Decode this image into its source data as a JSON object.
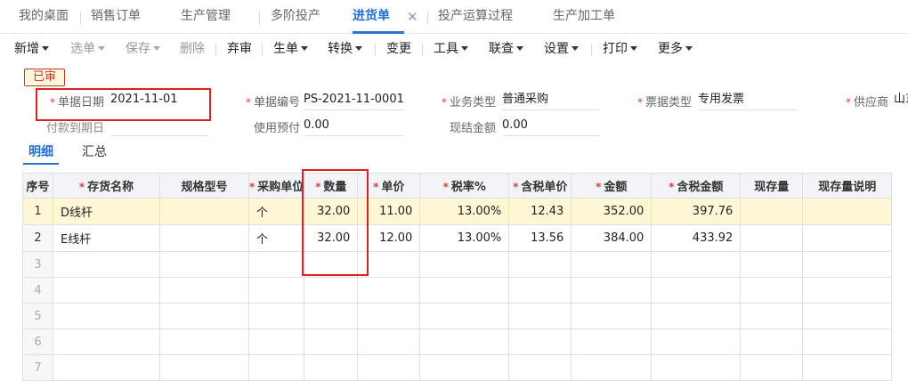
{
  "tabs": [
    {
      "label": "我的桌面"
    },
    {
      "label": "销售订单"
    },
    {
      "label": "生产管理"
    },
    {
      "label": "多阶投产"
    },
    {
      "label": "进货单"
    },
    {
      "label": "投产运算过程"
    },
    {
      "label": "生产加工单"
    }
  ],
  "tab_close_glyph": "✕",
  "toolbar": {
    "new": "新增",
    "pick": "选单",
    "save": "保存",
    "delete": "删除",
    "abandon": "弃审",
    "gen": "生单",
    "convert": "转换",
    "change": "变更",
    "tools": "工具",
    "query": "联查",
    "settings": "设置",
    "print": "打印",
    "more": "更多"
  },
  "status": "已审",
  "form": {
    "doc_date": {
      "label": "单据日期",
      "value": "2021-11-01"
    },
    "doc_no": {
      "label": "单据编号",
      "value": "PS-2021-11-0001"
    },
    "biz_type": {
      "label": "业务类型",
      "value": "普通采购"
    },
    "invoice_type": {
      "label": "票据类型",
      "value": "专用发票"
    },
    "supplier": {
      "label": "供应商",
      "value": "山东"
    },
    "pay_due": {
      "label": "付款到期日",
      "value": ""
    },
    "use_prepay": {
      "label": "使用预付",
      "value": "0.00"
    },
    "cash_amount": {
      "label": "现结金额",
      "value": "0.00"
    }
  },
  "subtabs": {
    "detail": "明细",
    "summary": "汇总"
  },
  "grid": {
    "headers": {
      "idx": "序号",
      "name": "存货名称",
      "spec": "规格型号",
      "unit": "采购单位",
      "qty": "数量",
      "price": "单价",
      "tax_rate": "税率%",
      "tax_price": "含税单价",
      "amount": "金额",
      "tax_amount": "含税金额",
      "stock": "现存量",
      "stock_note": "现存量说明"
    },
    "rows": [
      {
        "idx": "1",
        "name": "D线杆",
        "spec": "",
        "unit": "个",
        "qty": "32.00",
        "price": "11.00",
        "tax_rate": "13.00%",
        "tax_price": "12.43",
        "amount": "352.00",
        "tax_amount": "397.76",
        "stock": "",
        "stock_note": ""
      },
      {
        "idx": "2",
        "name": "E线杆",
        "spec": "",
        "unit": "个",
        "qty": "32.00",
        "price": "12.00",
        "tax_rate": "13.00%",
        "tax_price": "13.56",
        "amount": "384.00",
        "tax_amount": "433.92",
        "stock": "",
        "stock_note": ""
      },
      {
        "idx": "3"
      },
      {
        "idx": "4"
      },
      {
        "idx": "5"
      },
      {
        "idx": "6"
      },
      {
        "idx": "7"
      }
    ]
  }
}
